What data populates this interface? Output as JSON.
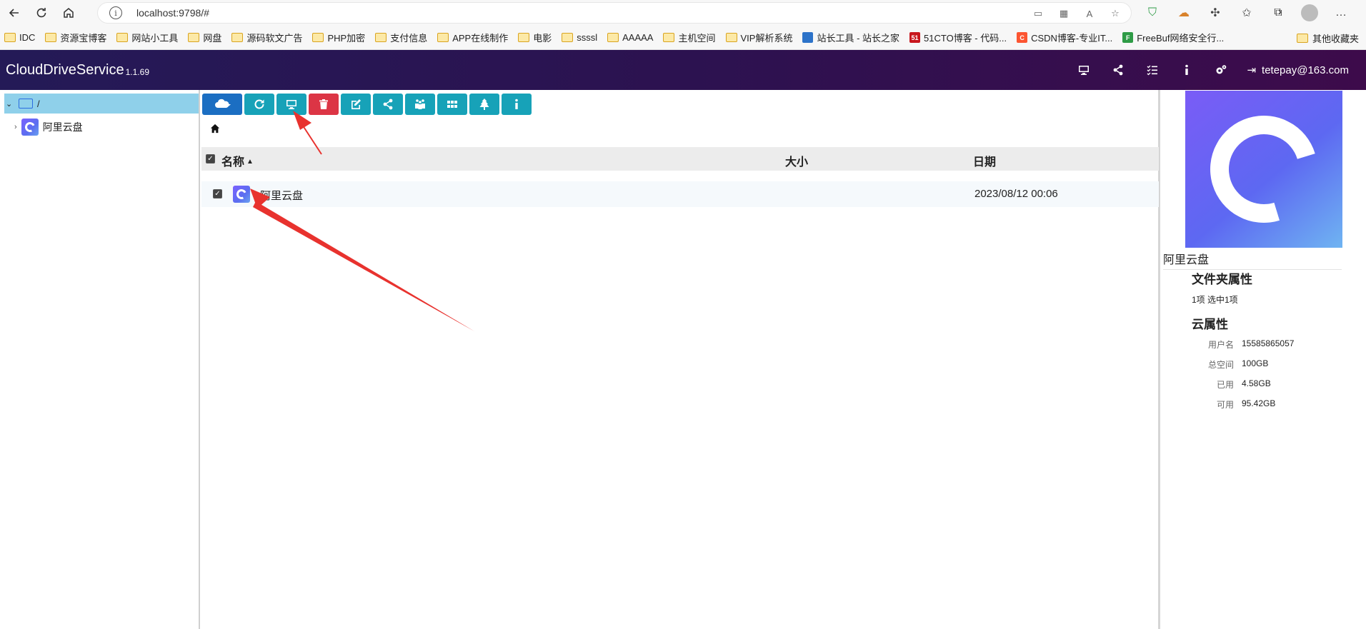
{
  "browser": {
    "url": "localhost:9798/#",
    "info_glyph": "i"
  },
  "bookmarks": [
    {
      "label": "IDC",
      "kind": "folder"
    },
    {
      "label": "资源宝博客",
      "kind": "folder"
    },
    {
      "label": "网站小工具",
      "kind": "folder"
    },
    {
      "label": "网盘",
      "kind": "folder"
    },
    {
      "label": "源码软文广告",
      "kind": "folder"
    },
    {
      "label": "PHP加密",
      "kind": "folder"
    },
    {
      "label": "支付信息",
      "kind": "folder"
    },
    {
      "label": "APP在线制作",
      "kind": "folder"
    },
    {
      "label": "电影",
      "kind": "folder"
    },
    {
      "label": "ssssl",
      "kind": "folder"
    },
    {
      "label": "AAAAA",
      "kind": "folder"
    },
    {
      "label": "主机空间",
      "kind": "folder"
    },
    {
      "label": "VIP解析系统",
      "kind": "folder"
    },
    {
      "label": "站长工具 - 站长之家",
      "kind": "site",
      "badge": "",
      "badge_color": "#2d73c9"
    },
    {
      "label": "51CTO博客 - 代码...",
      "kind": "site",
      "badge": "51",
      "badge_color": "#c8161d"
    },
    {
      "label": "CSDN博客-专业IT...",
      "kind": "site",
      "badge": "C",
      "badge_color": "#fc5531"
    },
    {
      "label": "FreeBuf网络安全行...",
      "kind": "site",
      "badge": "F",
      "badge_color": "#2e9b46"
    }
  ],
  "bookmarks_more": "›",
  "bookmarks_other": "其他收藏夹",
  "app": {
    "title": "CloudDriveService",
    "version": "1.1.69",
    "user": "tetepay@163.com"
  },
  "tree": {
    "root_label": "/",
    "child_label": "阿里云盘"
  },
  "table": {
    "col_name": "名称",
    "col_size": "大小",
    "col_date": "日期",
    "sort_glyph": "▲",
    "rows": [
      {
        "name": "阿里云盘",
        "size": "",
        "date": "2023/08/12 00:06",
        "checked": true
      }
    ]
  },
  "details": {
    "name": "阿里云盘",
    "folder_props_title": "文件夹属性",
    "folder_stat": "1项   选中1项",
    "cloud_props_title": "云属性",
    "props": [
      {
        "key": "用户名",
        "value": "15585865057"
      },
      {
        "key": "总空间",
        "value": "100GB"
      },
      {
        "key": "已用",
        "value": "4.58GB"
      },
      {
        "key": "可用",
        "value": "95.42GB"
      }
    ]
  },
  "colors": {
    "header_start": "#241a57",
    "header_end": "#3d0b4b",
    "button_info": "#17a2b8",
    "button_primary": "#1b6ec2",
    "button_danger": "#dc3545",
    "tree_selected": "#8fd0ea",
    "annotation_arrow": "#e8322e"
  }
}
